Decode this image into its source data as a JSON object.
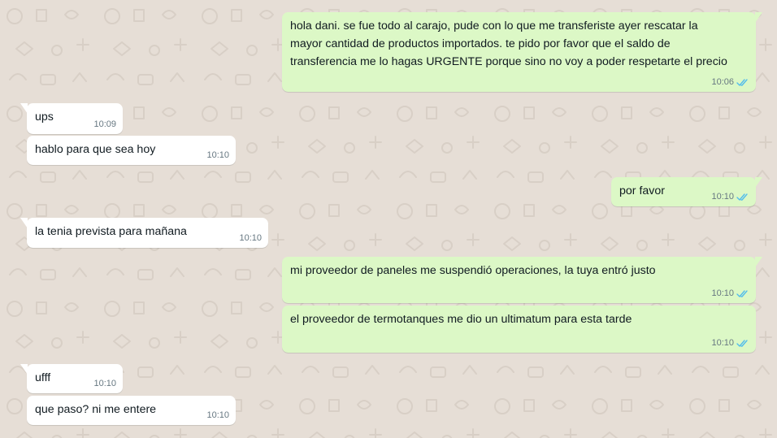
{
  "messages": [
    {
      "direction": "out",
      "text": "hola dani. se fue todo al carajo, pude con lo que me transferiste ayer rescatar la mayor cantidad de productos importados. te pido por favor que el saldo de transferencia me lo hagas URGENTE porque sino no voy a poder respetarte el precio",
      "time": "10:06",
      "status": "read"
    },
    {
      "direction": "in",
      "text": "ups",
      "time": "10:09"
    },
    {
      "direction": "in",
      "text": "hablo para que sea hoy",
      "time": "10:10"
    },
    {
      "direction": "out",
      "text": "por favor",
      "time": "10:10",
      "status": "read"
    },
    {
      "direction": "in",
      "text": "la tenia prevista para mañana",
      "time": "10:10"
    },
    {
      "direction": "out",
      "text": "mi proveedor de paneles me suspendió operaciones, la tuya entró justo",
      "time": "10:10",
      "status": "read"
    },
    {
      "direction": "out",
      "text": "el proveedor de termotanques me dio un ultimatum para esta tarde",
      "time": "10:10",
      "status": "read"
    },
    {
      "direction": "in",
      "text": "ufff",
      "time": "10:10"
    },
    {
      "direction": "in",
      "text": "que paso? ni me entere",
      "time": "10:10"
    }
  ],
  "colors": {
    "background": "#e6ded6",
    "incoming_bubble": "#ffffff",
    "outgoing_bubble": "#dcf8c6",
    "read_check": "#53bdeb",
    "meta_text": "#667781"
  },
  "icons": {
    "read_status": "double-check-icon"
  }
}
